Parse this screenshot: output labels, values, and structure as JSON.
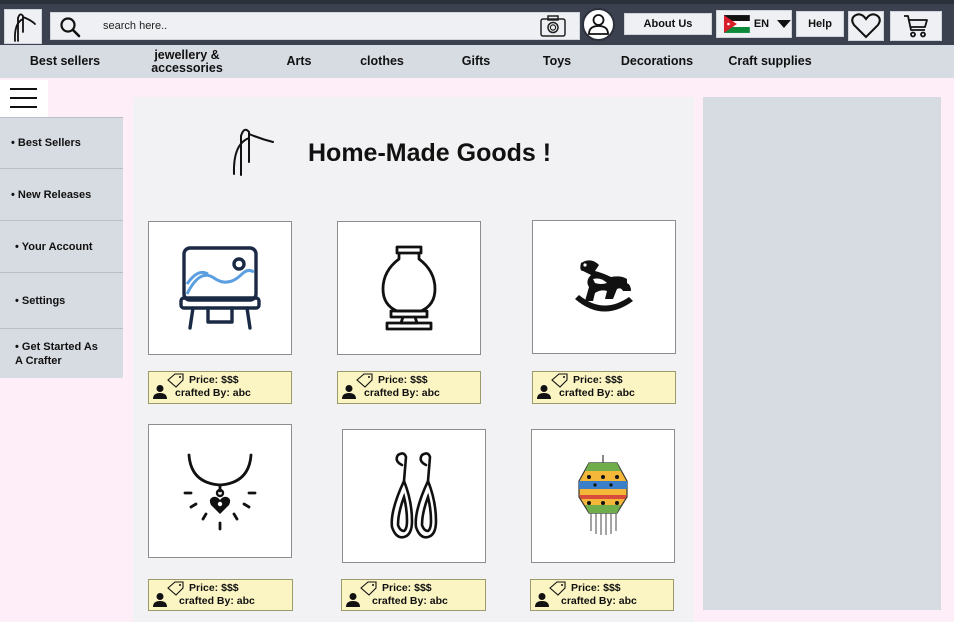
{
  "header": {
    "search_placeholder": "search here..",
    "about_label": "About Us",
    "language": "EN",
    "help_label": "Help",
    "icons": [
      "needle-thread-logo-icon",
      "search-icon",
      "camera-icon",
      "user-icon",
      "jordan-flag-icon",
      "caret-down-icon",
      "heart-icon",
      "cart-icon"
    ]
  },
  "categories": [
    "Best sellers",
    "jewellery &\naccessories",
    "Arts",
    "clothes",
    "Gifts",
    "Toys",
    "Decorations",
    "Craft supplies"
  ],
  "sidebar": {
    "items": [
      {
        "label": "• Best Sellers"
      },
      {
        "label": "• New Releases"
      },
      {
        "label": "• Your Account"
      },
      {
        "label": "• Settings"
      },
      {
        "label": "• Get Started As\nA Crafter"
      }
    ]
  },
  "main": {
    "title": "Home-Made Goods !",
    "products": [
      {
        "icon": "painting-easel-icon",
        "price": "Price: $$$",
        "crafter": "crafted By: abc"
      },
      {
        "icon": "pottery-vase-icon",
        "price": "Price: $$$",
        "crafter": "crafted By: abc"
      },
      {
        "icon": "rocking-horse-icon",
        "price": "Price: $$$",
        "crafter": "crafted By: abc"
      },
      {
        "icon": "heart-necklace-icon",
        "price": "Price: $$$",
        "crafter": "crafted By: abc"
      },
      {
        "icon": "drop-earrings-icon",
        "price": "Price: $$$",
        "crafter": "crafted By: abc"
      },
      {
        "icon": "beaded-lantern-icon",
        "price": "Price: $$$",
        "crafter": "crafted By: abc"
      }
    ]
  },
  "colors": {
    "topbar": "#3c4150",
    "nav": "#d7dbe2",
    "page_bg": "#fdeef8",
    "price_tag_bg": "#fbf5c4"
  }
}
